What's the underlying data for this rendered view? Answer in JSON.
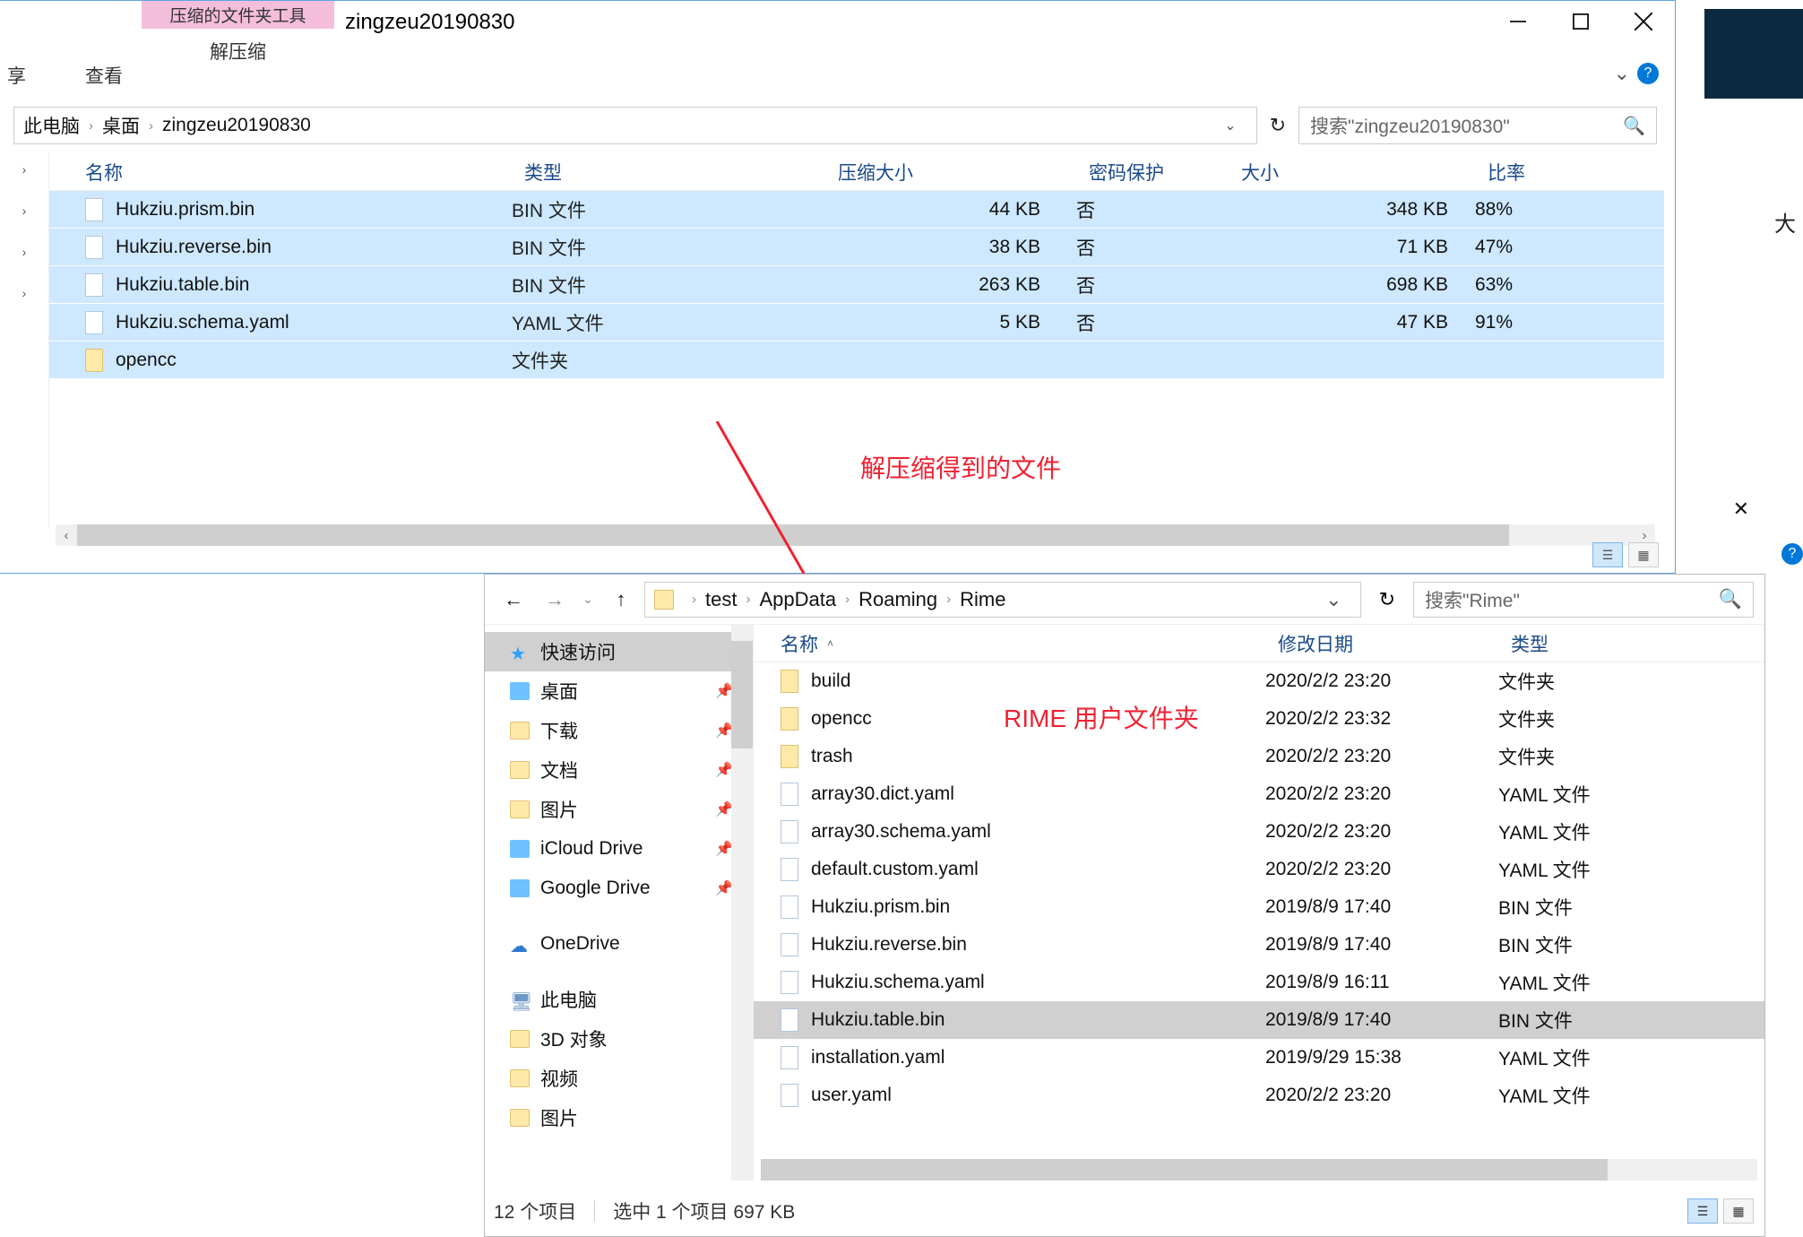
{
  "win1": {
    "context_tool_label": "压缩的文件夹工具",
    "context_tab": "解压缩",
    "title": "zingzeu20190830",
    "ribbon_tabs": [
      "享",
      "查看"
    ],
    "breadcrumb": [
      "此电脑",
      "桌面",
      "zingzeu20190830"
    ],
    "search_placeholder": "搜索\"zingzeu20190830\"",
    "columns": {
      "name": "名称",
      "type": "类型",
      "comp": "压缩大小",
      "pass": "密码保护",
      "size": "大小",
      "ratio": "比率"
    },
    "rows": [
      {
        "icon": "file",
        "name": "Hukziu.prism.bin",
        "type": "BIN 文件",
        "comp": "44 KB",
        "pass": "否",
        "size": "348 KB",
        "ratio": "88%"
      },
      {
        "icon": "file",
        "name": "Hukziu.reverse.bin",
        "type": "BIN 文件",
        "comp": "38 KB",
        "pass": "否",
        "size": "71 KB",
        "ratio": "47%"
      },
      {
        "icon": "file",
        "name": "Hukziu.table.bin",
        "type": "BIN 文件",
        "comp": "263 KB",
        "pass": "否",
        "size": "698 KB",
        "ratio": "63%"
      },
      {
        "icon": "file",
        "name": "Hukziu.schema.yaml",
        "type": "YAML 文件",
        "comp": "5 KB",
        "pass": "否",
        "size": "47 KB",
        "ratio": "91%"
      },
      {
        "icon": "fld",
        "name": "opencc",
        "type": "文件夹",
        "comp": "",
        "pass": "",
        "size": "",
        "ratio": ""
      }
    ],
    "annotation": "解压缩得到的文件"
  },
  "win2": {
    "breadcrumb": [
      "test",
      "AppData",
      "Roaming",
      "Rime"
    ],
    "search_placeholder": "搜索\"Rime\"",
    "tree": [
      {
        "icon": "star",
        "label": "快速访问",
        "sel": true
      },
      {
        "icon": "blue",
        "label": "桌面",
        "pin": true
      },
      {
        "icon": "fld2",
        "label": "下载",
        "pin": true
      },
      {
        "icon": "fld2",
        "label": "文档",
        "pin": true
      },
      {
        "icon": "fld2",
        "label": "图片",
        "pin": true
      },
      {
        "icon": "blue",
        "label": "iCloud Drive",
        "pin": true
      },
      {
        "icon": "blue",
        "label": "Google Drive",
        "pin": true
      },
      {
        "icon": "cloud",
        "label": "OneDrive",
        "spacer": true
      },
      {
        "icon": "pc",
        "label": "此电脑",
        "spacer": true
      },
      {
        "icon": "fld2",
        "label": "3D 对象"
      },
      {
        "icon": "fld2",
        "label": "视频"
      },
      {
        "icon": "fld2",
        "label": "图片"
      }
    ],
    "columns": {
      "name": "名称",
      "date": "修改日期",
      "type": "类型"
    },
    "rows": [
      {
        "icon": "fld",
        "name": "build",
        "date": "2020/2/2 23:20",
        "type": "文件夹"
      },
      {
        "icon": "fld",
        "name": "opencc",
        "date": "2020/2/2 23:32",
        "type": "文件夹"
      },
      {
        "icon": "fld",
        "name": "trash",
        "date": "2020/2/2 23:20",
        "type": "文件夹"
      },
      {
        "icon": "file",
        "name": "array30.dict.yaml",
        "date": "2020/2/2 23:20",
        "type": "YAML 文件"
      },
      {
        "icon": "file",
        "name": "array30.schema.yaml",
        "date": "2020/2/2 23:20",
        "type": "YAML 文件"
      },
      {
        "icon": "file",
        "name": "default.custom.yaml",
        "date": "2020/2/2 23:20",
        "type": "YAML 文件"
      },
      {
        "icon": "file",
        "name": "Hukziu.prism.bin",
        "date": "2019/8/9 17:40",
        "type": "BIN 文件"
      },
      {
        "icon": "file",
        "name": "Hukziu.reverse.bin",
        "date": "2019/8/9 17:40",
        "type": "BIN 文件"
      },
      {
        "icon": "file",
        "name": "Hukziu.schema.yaml",
        "date": "2019/8/9 16:11",
        "type": "YAML 文件"
      },
      {
        "icon": "file",
        "name": "Hukziu.table.bin",
        "date": "2019/8/9 17:40",
        "type": "BIN 文件",
        "sel": true
      },
      {
        "icon": "file",
        "name": "installation.yaml",
        "date": "2019/9/29 15:38",
        "type": "YAML 文件"
      },
      {
        "icon": "file",
        "name": "user.yaml",
        "date": "2020/2/2 23:20",
        "type": "YAML 文件"
      }
    ],
    "annotation": "RIME 用户文件夹",
    "status_count": "12 个项目",
    "status_sel": "选中 1 个项目 697 KB"
  },
  "side_text": "大"
}
